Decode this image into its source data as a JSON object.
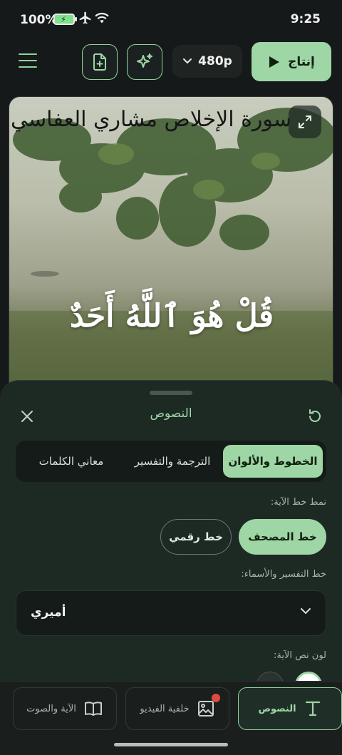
{
  "status_bar": {
    "battery": "100%",
    "time": "9:25",
    "icons": [
      "battery-charging-icon",
      "airplane-icon",
      "wifi-icon"
    ]
  },
  "toolbar": {
    "resolution": "480p",
    "produce_label": "إنتاج",
    "icons": [
      "menu-icon",
      "add-file-icon",
      "sparkle-icon",
      "chevron-down-icon",
      "play-icon"
    ]
  },
  "preview": {
    "surah_title": "سورة الإخلاص مشاري العفاسي",
    "verse": "قُلْ هُوَ ٱللَّهُ أَحَدٌ"
  },
  "sheet": {
    "title": "النصوص",
    "tabs": [
      {
        "label": "الخطوط والألوان",
        "active": true
      },
      {
        "label": "الترجمة والتفسير",
        "active": false
      },
      {
        "label": "معاني الكلمات",
        "active": false
      }
    ],
    "verse_font_label": "نمط خط الآية:",
    "verse_font_options": [
      {
        "label": "خط المصحف",
        "selected": true
      },
      {
        "label": "خط رقمي",
        "selected": false
      }
    ],
    "tafsir_font_label": "خط التفسير والأسماء:",
    "tafsir_font_value": "أميري",
    "verse_color_label": "لون نص الآية:"
  },
  "nav": {
    "items": [
      {
        "label": "النصوص",
        "icon": "text-icon",
        "active": true
      },
      {
        "label": "خلفية الفيديو",
        "icon": "image-icon",
        "active": false,
        "badge": true
      },
      {
        "label": "الآية والصوت",
        "icon": "book-icon",
        "active": false
      }
    ]
  },
  "colors": {
    "accent": "#9ed6a5",
    "background": "#15191a",
    "sheet": "#1d2a24",
    "badge": "#e04a45"
  }
}
